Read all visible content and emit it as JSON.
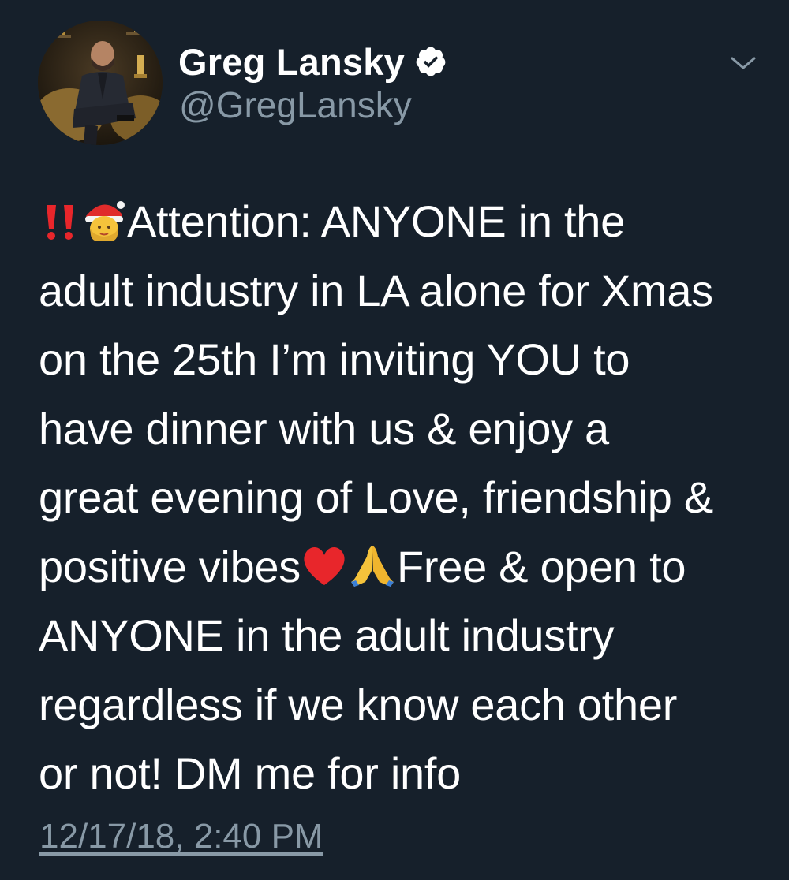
{
  "author": {
    "display_name": "Greg Lansky",
    "handle": "@GregLansky",
    "verified": true
  },
  "icons": {
    "avatar": "profile-photo",
    "verified": "verified-badge-icon",
    "more": "chevron-down-icon"
  },
  "tweet": {
    "lines": [
      "Attention: ANYONE in the",
      "adult industry in LA alone for Xmas",
      "on the 25th I’m inviting YOU to",
      "have dinner with us & enjoy a",
      "great evening of Love, friendship &",
      "positive vibes",
      "Free & open to",
      "ANYONE in the adult industry",
      "regardless if we know each other",
      "or not! DM me for info"
    ],
    "emojis": [
      "double-exclamation-mark",
      "mrs-claus-face",
      "red-heart",
      "folded-hands"
    ],
    "timestamp": "12/17/18, 2:40 PM"
  },
  "colors": {
    "background": "#16202b",
    "text": "#ffffff",
    "secondary": "#8899a6"
  }
}
